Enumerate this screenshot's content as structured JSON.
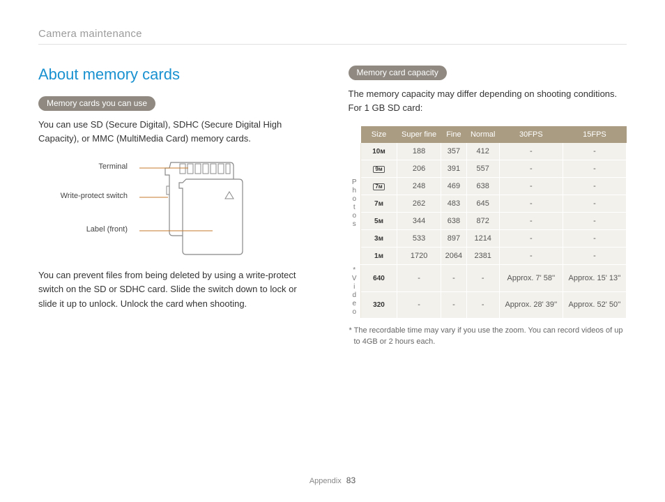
{
  "header": {
    "section": "Camera maintenance"
  },
  "left": {
    "heading": "About memory cards",
    "pill1": "Memory cards you can use",
    "para1": "You can use SD (Secure Digital), SDHC (Secure Digital High Capacity), or MMC (MultiMedia Card) memory cards.",
    "callouts": {
      "terminal": "Terminal",
      "wp": "Write-protect switch",
      "label": "Label (front)"
    },
    "para2": "You can prevent files from being deleted by using a write-protect switch on the SD or SDHC card. Slide the switch down to lock or slide it up to unlock. Unlock the card when shooting."
  },
  "right": {
    "pill2": "Memory card capacity",
    "intro": "The memory capacity may differ depending on shooting conditions. For 1 GB SD card:",
    "table": {
      "headers": [
        "Size",
        "Super fine",
        "Fine",
        "Normal",
        "30FPS",
        "15FPS"
      ],
      "groups": {
        "photos": "Photos",
        "video": "* Video"
      },
      "photoRows": [
        {
          "size": "10ᴍ",
          "sizeStyle": "plain",
          "vals": [
            "188",
            "357",
            "412",
            "-",
            "-"
          ]
        },
        {
          "size": "9ᴍ",
          "sizeStyle": "box",
          "vals": [
            "206",
            "391",
            "557",
            "-",
            "-"
          ]
        },
        {
          "size": "7ᴍ",
          "sizeStyle": "box",
          "vals": [
            "248",
            "469",
            "638",
            "-",
            "-"
          ]
        },
        {
          "size": "7ᴍ",
          "sizeStyle": "plain",
          "vals": [
            "262",
            "483",
            "645",
            "-",
            "-"
          ]
        },
        {
          "size": "5ᴍ",
          "sizeStyle": "plain",
          "vals": [
            "344",
            "638",
            "872",
            "-",
            "-"
          ]
        },
        {
          "size": "3ᴍ",
          "sizeStyle": "plain",
          "vals": [
            "533",
            "897",
            "1214",
            "-",
            "-"
          ]
        },
        {
          "size": "1ᴍ",
          "sizeStyle": "plain",
          "vals": [
            "1720",
            "2064",
            "2381",
            "-",
            "-"
          ]
        }
      ],
      "videoRows": [
        {
          "size": "640",
          "vals": [
            "-",
            "-",
            "-",
            "Approx. 7' 58''",
            "Approx. 15' 13''"
          ]
        },
        {
          "size": "320",
          "vals": [
            "-",
            "-",
            "-",
            "Approx. 28' 39''",
            "Approx. 52' 50''"
          ]
        }
      ]
    },
    "footnote": "* The recordable time may vary if you use the zoom. You can record videos of up to 4GB or 2 hours each."
  },
  "footer": {
    "label": "Appendix",
    "page": "83"
  }
}
